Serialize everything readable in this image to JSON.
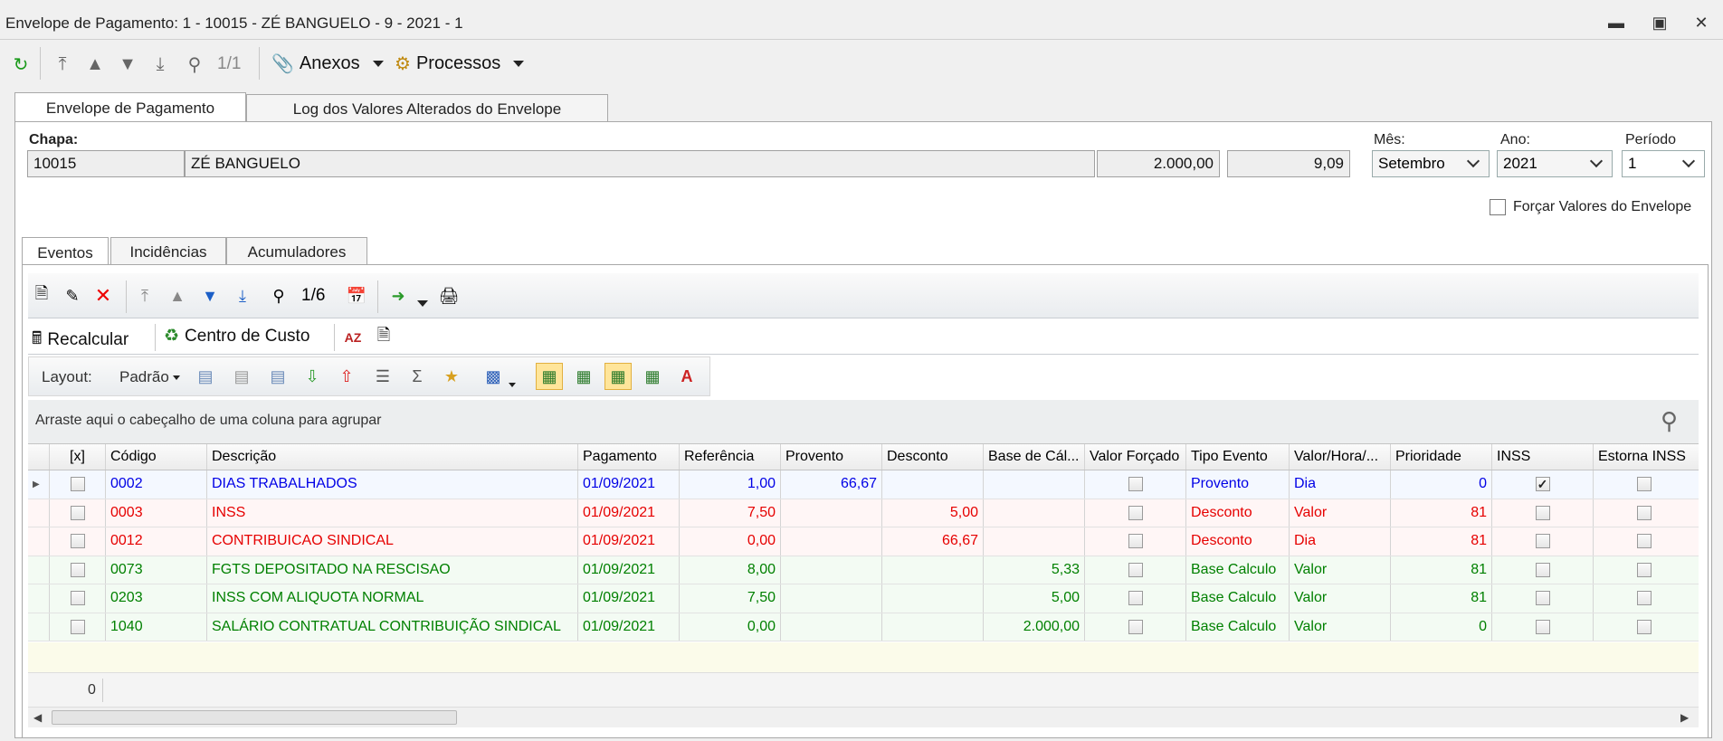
{
  "window": {
    "title": "Envelope de Pagamento: 1 - 10015 - ZÉ BANGUELO - 9 - 2021 - 1"
  },
  "toolbar": {
    "record_nav": "1/1",
    "anexos_label": "Anexos",
    "processos_label": "Processos"
  },
  "tabs": {
    "envelope": "Envelope de Pagamento",
    "log": "Log dos Valores Alterados do Envelope"
  },
  "header": {
    "chapa_label": "Chapa:",
    "chapa_value": "10015",
    "name_value": "ZÉ BANGUELO",
    "salary_value": "2.000,00",
    "hour_value": "9,09",
    "mes_label": "Mês:",
    "mes_value": "Setembro",
    "ano_label": "Ano:",
    "ano_value": "2021",
    "periodo_label": "Período",
    "periodo_value": "1",
    "forcar_label": "Forçar Valores do Envelope"
  },
  "subtabs": {
    "eventos": "Eventos",
    "incidencias": "Incidências",
    "acumuladores": "Acumuladores"
  },
  "grid_toolbar": {
    "record_nav": "1/6",
    "recalcular": "Recalcular",
    "centro_custo": "Centro de Custo",
    "layout_label": "Layout:",
    "layout_value": "Padrão",
    "group_hint": "Arraste aqui o cabeçalho de uma coluna para agrupar"
  },
  "columns": [
    "[x]",
    "Código",
    "Descrição",
    "Pagamento",
    "Referência",
    "Provento",
    "Desconto",
    "Base de Cál...",
    "Valor Forçado",
    "Tipo Evento",
    "Valor/Hora/...",
    "Prioridade",
    "INSS",
    "Estorna INSS"
  ],
  "rows": [
    {
      "codigo": "0002",
      "descricao": "DIAS TRABALHADOS",
      "pagamento": "01/09/2021",
      "referencia": "1,00",
      "provento": "66,67",
      "desconto": "",
      "base": "",
      "tipo": "Provento",
      "valor_hora": "Dia",
      "prioridade": "0",
      "inss": true
    },
    {
      "codigo": "0003",
      "descricao": "INSS",
      "pagamento": "01/09/2021",
      "referencia": "7,50",
      "provento": "",
      "desconto": "5,00",
      "base": "",
      "tipo": "Desconto",
      "valor_hora": "Valor",
      "prioridade": "81",
      "inss": false
    },
    {
      "codigo": "0012",
      "descricao": "CONTRIBUICAO SINDICAL",
      "pagamento": "01/09/2021",
      "referencia": "0,00",
      "provento": "",
      "desconto": "66,67",
      "base": "",
      "tipo": "Desconto",
      "valor_hora": "Dia",
      "prioridade": "81",
      "inss": false
    },
    {
      "codigo": "0073",
      "descricao": "FGTS DEPOSITADO NA RESCISAO",
      "pagamento": "01/09/2021",
      "referencia": "8,00",
      "provento": "",
      "desconto": "",
      "base": "5,33",
      "tipo": "Base Calculo",
      "valor_hora": "Valor",
      "prioridade": "81",
      "inss": false
    },
    {
      "codigo": "0203",
      "descricao": "INSS COM ALIQUOTA NORMAL",
      "pagamento": "01/09/2021",
      "referencia": "7,50",
      "provento": "",
      "desconto": "",
      "base": "5,00",
      "tipo": "Base Calculo",
      "valor_hora": "Valor",
      "prioridade": "81",
      "inss": false
    },
    {
      "codigo": "1040",
      "descricao": "SALÁRIO CONTRATUAL CONTRIBUIÇÃO SINDICAL",
      "pagamento": "01/09/2021",
      "referencia": "0,00",
      "provento": "",
      "desconto": "",
      "base": "2.000,00",
      "tipo": "Base Calculo",
      "valor_hora": "Valor",
      "prioridade": "0",
      "inss": false
    }
  ],
  "footer": {
    "count": "0"
  },
  "colors": {
    "provento": "#0000e6",
    "desconto": "#e60000",
    "base": "#008000"
  }
}
